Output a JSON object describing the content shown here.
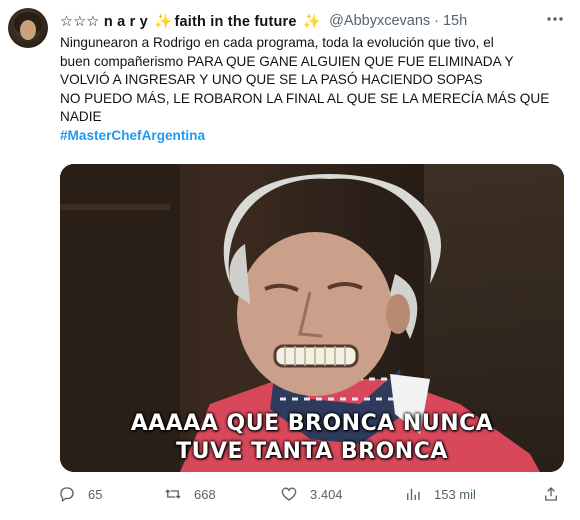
{
  "tweet": {
    "display_name": "☆☆☆ n a r y",
    "name_spark": "✨",
    "name_suffix": "faith in the future",
    "name_spark_end": "✨",
    "handle": "@Abbyxcevans",
    "dot": "·",
    "time": "15h",
    "lines": [
      "Ningunearon a Rodrigo en cada programa, toda la evolución que tivo, el",
      "buen compañerismo PARA QUE GANE ALGUIEN QUE FUE ELIMINADA Y",
      "VOLVIÓ A INGRESAR Y UNO QUE SE LA PASÓ HACIENDO SOPAS",
      "NO PUEDO MÁS, LE ROBARON LA FINAL AL QUE SE LA MERECÍA MÁS QUE",
      "NADIE"
    ],
    "hashtag": "#MasterChefArgentina",
    "media_caption_line1": "AAAAA QUE BRONCA NUNCA",
    "media_caption_line2": "TUVE TANTA BRONCA"
  },
  "actions": {
    "replies": "65",
    "retweets": "668",
    "likes": "3.404",
    "views": "153 mil"
  },
  "icons": {
    "more": "more-icon",
    "reply": "reply-icon",
    "retweet": "retweet-icon",
    "like": "heart-icon",
    "views": "views-icon",
    "share": "share-icon"
  }
}
